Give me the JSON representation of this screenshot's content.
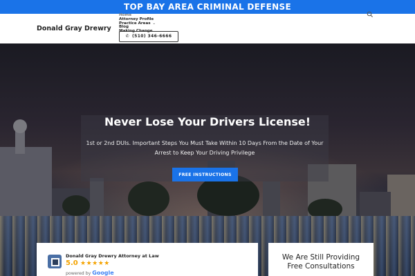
{
  "banner": {
    "text": "TOP BAY AREA CRIMINAL DEFENSE"
  },
  "header": {
    "brand": "Donald Gray Drewry",
    "nav": [
      {
        "label": "Home"
      },
      {
        "label": "Attorney Profile"
      },
      {
        "label": "Practice Areas",
        "has_dropdown": true
      },
      {
        "label": "Blog"
      },
      {
        "label": "Making Change"
      }
    ],
    "phone": "(510) 346-6666",
    "icons": {
      "phone": "phone-icon",
      "search": "search-icon",
      "dropdown": "chevron-down-icon"
    }
  },
  "hero": {
    "title": "Never Lose Your Drivers License!",
    "subtitle": "1st or 2nd DUIs. Important Steps You Must Take Within 10 Days From the Date of Your Arrest to Keep Your Driving Privilege",
    "cta_label": "FREE INSTRUCTIONS"
  },
  "review": {
    "name": "Donald Gray Drewry Attorney at Law",
    "score": "5.0",
    "stars": "★★★★★",
    "rating": 5,
    "powered_prefix": "powered by",
    "powered_brand": "Google"
  },
  "consult": {
    "line1": "We Are Still Providing",
    "line2": "Free Consultations"
  },
  "colors": {
    "accent": "#1a73e8",
    "star": "#f4a300"
  }
}
